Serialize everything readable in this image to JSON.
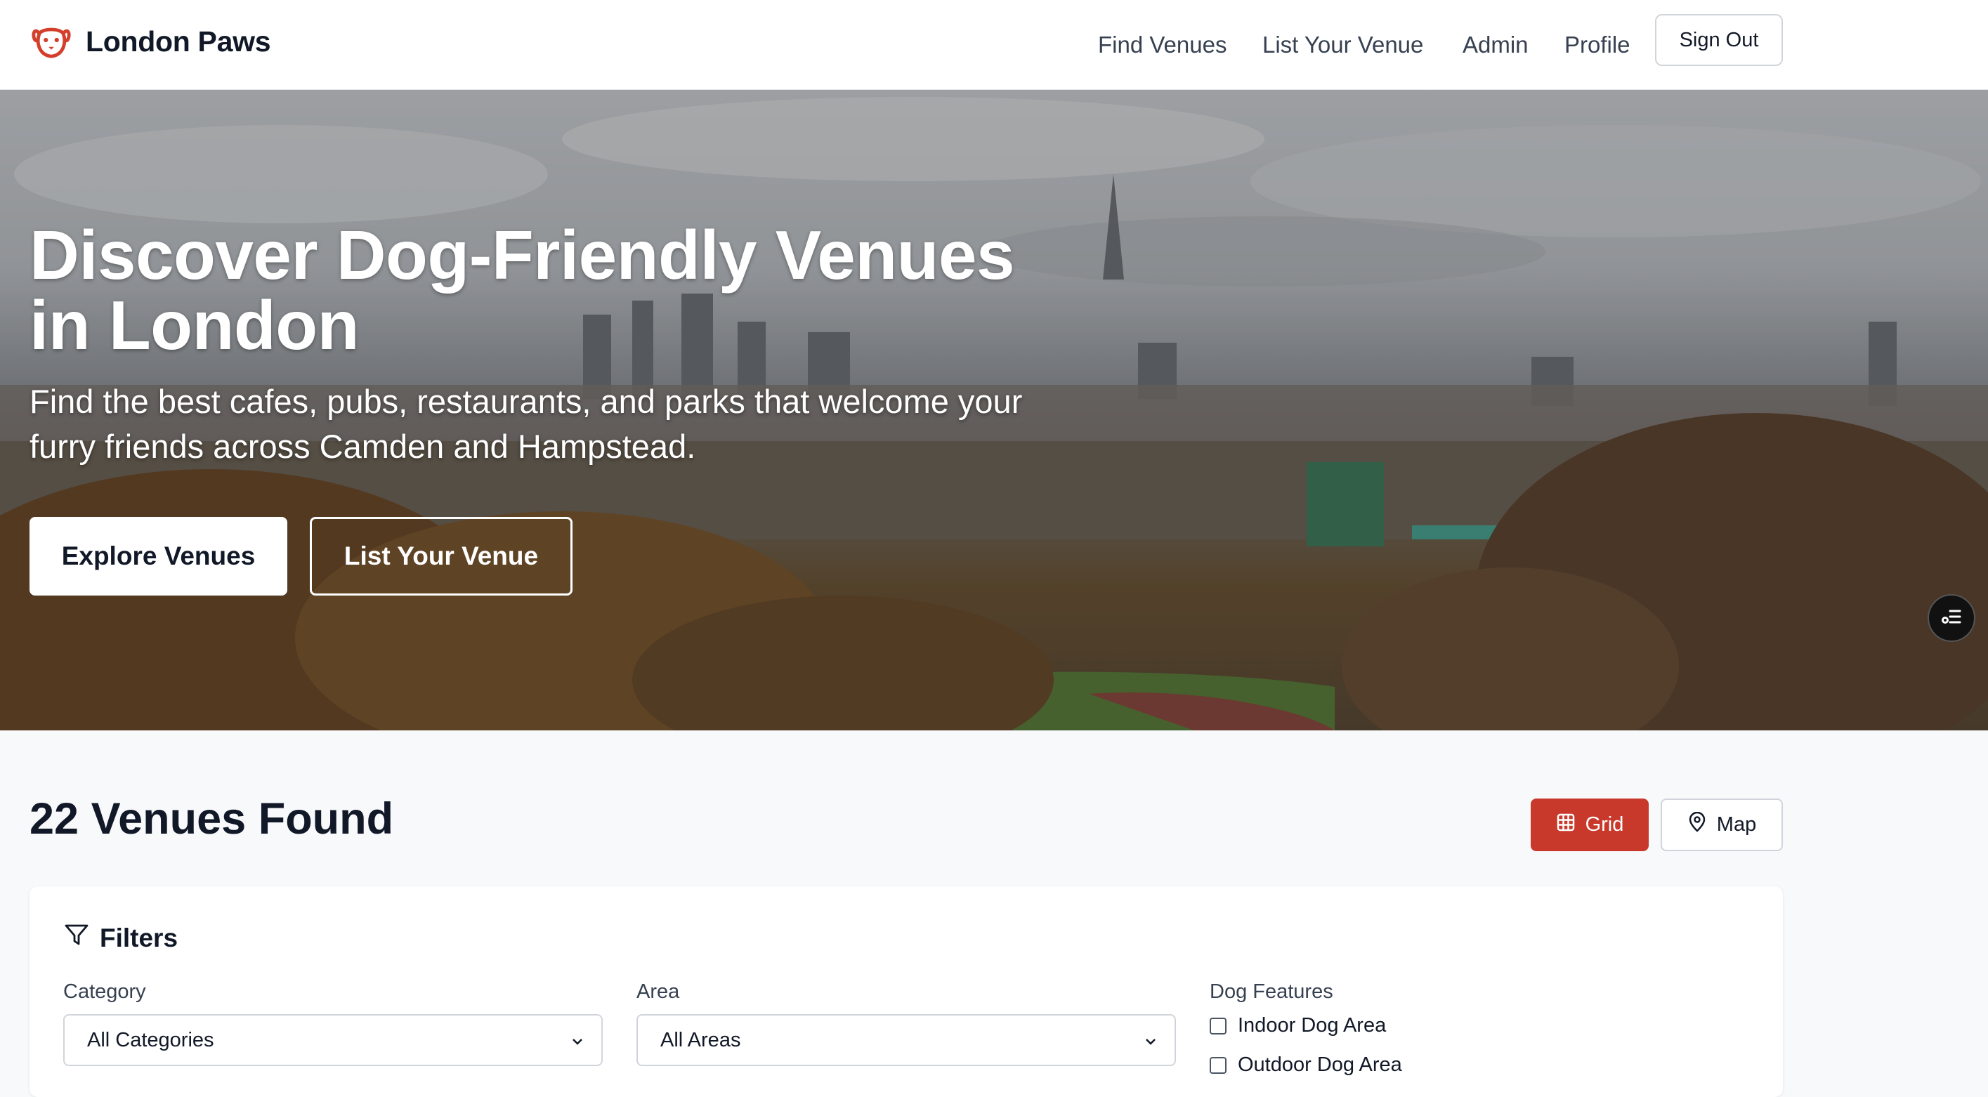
{
  "header": {
    "brand": "London Paws",
    "nav": [
      "Find Venues",
      "List Your Venue",
      "Admin",
      "Profile"
    ],
    "sign_out": "Sign Out"
  },
  "hero": {
    "title": "Discover Dog-Friendly Venues in London",
    "subtitle": "Find the best cafes, pubs, restaurants, and parks that welcome your furry friends across Camden and Hampstead.",
    "primary_button": "Explore Venues",
    "secondary_button": "List Your Venue"
  },
  "results": {
    "count_label": "22 Venues Found",
    "view_grid": "Grid",
    "view_map": "Map",
    "active_view": "Grid"
  },
  "filters": {
    "heading": "Filters",
    "category_label": "Category",
    "category_value": "All Categories",
    "area_label": "Area",
    "area_value": "All Areas",
    "features_label": "Dog Features",
    "features": [
      {
        "label": "Indoor Dog Area",
        "checked": false
      },
      {
        "label": "Outdoor Dog Area",
        "checked": false
      }
    ]
  },
  "colors": {
    "accent": "#c8392b",
    "text": "#111827",
    "page_bg": "#f8f9fb"
  },
  "icons": [
    "dog-logo-icon",
    "grid-icon",
    "map-pin-icon",
    "filter-icon",
    "chevron-down-icon",
    "floating-menu-icon"
  ]
}
